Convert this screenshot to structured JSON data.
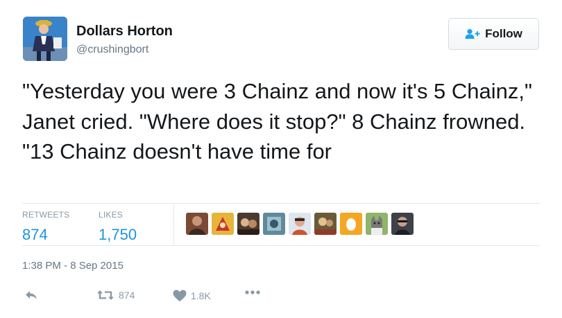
{
  "user": {
    "name": "Dollars Horton",
    "handle": "@crushingbort"
  },
  "follow_button": {
    "label": "Follow"
  },
  "tweet": {
    "text": "\"Yesterday you were 3 Chainz and now it's 5 Chainz,\" Janet cried. \"Where does it stop?\" 8 Chainz frowned. \"13 Chainz doesn't have time for"
  },
  "stats": {
    "retweets_label": "RETWEETS",
    "retweets": "874",
    "likes_label": "LIKES",
    "likes": "1,750"
  },
  "likers": [
    "avatar-1",
    "avatar-2",
    "avatar-3",
    "avatar-4",
    "avatar-5",
    "avatar-6",
    "avatar-7",
    "avatar-8",
    "avatar-9"
  ],
  "timestamp": "1:38 PM - 8 Sep 2015",
  "actions": {
    "reply_icon": "reply-icon",
    "retweet_icon": "retweet-icon",
    "retweet_count": "874",
    "like_icon": "heart-icon",
    "like_count": "1.8K",
    "more_icon": "more-icon"
  },
  "colors": {
    "link_blue": "#1b95e0",
    "muted_gray": "#8899a6",
    "text_dark": "#14171a",
    "follow_icon_blue": "#1da1f2"
  }
}
